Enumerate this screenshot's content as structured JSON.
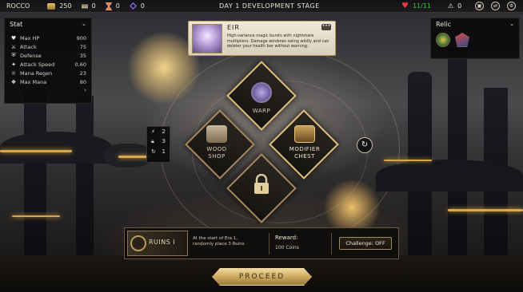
{
  "topbar": {
    "player": "ROCCO",
    "gold": "250",
    "res2": "0",
    "res3": "0",
    "res4": "0",
    "stage": "DAY 1 DEVELOPMENT STAGE",
    "hp": "11/11",
    "warnings": "0"
  },
  "stats": {
    "title": "Stat",
    "items": [
      {
        "icon": "heart-icon",
        "name": "Max HP",
        "value": "900"
      },
      {
        "icon": "attack-icon",
        "name": "Attack",
        "value": "75"
      },
      {
        "icon": "defense-icon",
        "name": "Defense",
        "value": "35"
      },
      {
        "icon": "attack-speed-icon",
        "name": "Attack Speed",
        "value": "0.60"
      },
      {
        "icon": "mana-regen-icon",
        "name": "Mana Regen",
        "value": "23"
      },
      {
        "icon": "max-mana-icon",
        "name": "Max Mana",
        "value": "80"
      }
    ]
  },
  "relic": {
    "title": "Relic"
  },
  "hero": {
    "name": "EIR",
    "desc": "High-variance magic bursts with nightmare multipliers. Damage windows swing wildly and can deleter your health bar without warning."
  },
  "tiles": {
    "warp": "WARP",
    "wood_shop": "WOOD SHOP",
    "modifier_chest": "MODIFIER CHEST"
  },
  "side": {
    "r1": "2",
    "r2": "3",
    "r3": "1"
  },
  "event": {
    "title": "RUINS I",
    "desc": "At the start of Era 1, randomly place 3 Ruins",
    "reward_label": "Reward:",
    "reward_value": "100 Coins",
    "challenge": "Challenge: OFF"
  },
  "proceed": "PROCEED",
  "colors": {
    "accent": "#d9a64a",
    "hp": "#3ec83e",
    "heart": "#e03a3a"
  }
}
